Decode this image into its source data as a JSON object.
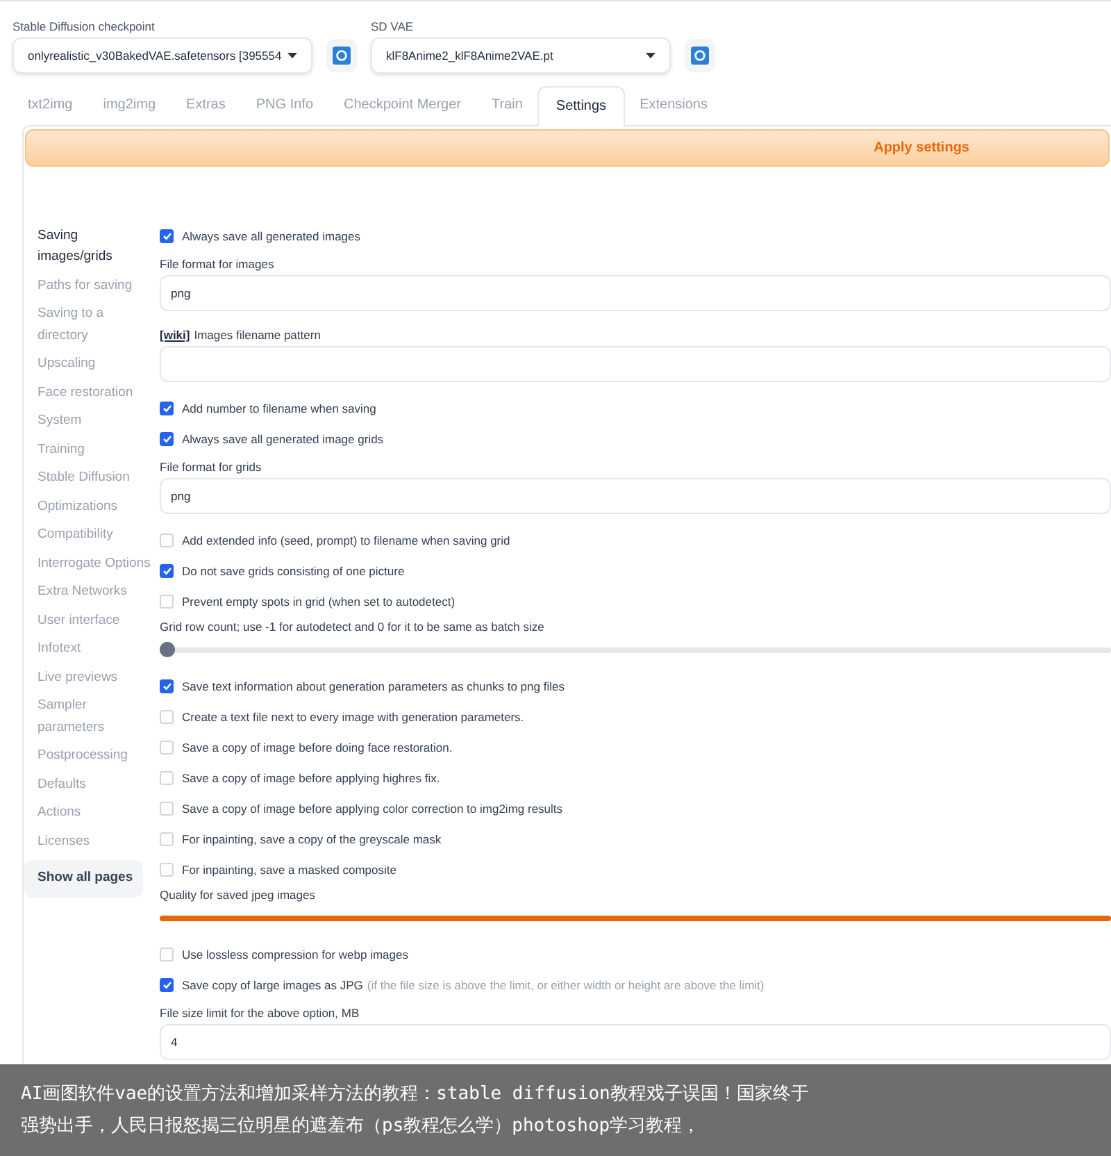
{
  "models": [
    {
      "label": "Stable Diffusion checkpoint",
      "value": "onlyrealistic_v30BakedVAE.safetensors [395554"
    },
    {
      "label": "SD VAE",
      "value": "klF8Anime2_klF8Anime2VAE.pt"
    }
  ],
  "tabs": [
    {
      "label": "txt2img",
      "selected": false
    },
    {
      "label": "img2img",
      "selected": false
    },
    {
      "label": "Extras",
      "selected": false
    },
    {
      "label": "PNG Info",
      "selected": false
    },
    {
      "label": "Checkpoint Merger",
      "selected": false
    },
    {
      "label": "Train",
      "selected": false
    },
    {
      "label": "Settings",
      "selected": true
    },
    {
      "label": "Extensions",
      "selected": false
    }
  ],
  "apply_button": "Apply settings",
  "sidebar": {
    "items": [
      {
        "label": "Saving images/grids",
        "selected": true
      },
      {
        "label": "Paths for saving",
        "selected": false
      },
      {
        "label": "Saving to a directory",
        "selected": false
      },
      {
        "label": "Upscaling",
        "selected": false
      },
      {
        "label": "Face restoration",
        "selected": false
      },
      {
        "label": "System",
        "selected": false
      },
      {
        "label": "Training",
        "selected": false
      },
      {
        "label": "Stable Diffusion",
        "selected": false
      },
      {
        "label": "Optimizations",
        "selected": false
      },
      {
        "label": "Compatibility",
        "selected": false
      },
      {
        "label": "Interrogate Options",
        "selected": false
      },
      {
        "label": "Extra Networks",
        "selected": false
      },
      {
        "label": "User interface",
        "selected": false
      },
      {
        "label": "Infotext",
        "selected": false
      },
      {
        "label": "Live previews",
        "selected": false
      },
      {
        "label": "Sampler parameters",
        "selected": false
      },
      {
        "label": "Postprocessing",
        "selected": false
      },
      {
        "label": "Defaults",
        "selected": false
      },
      {
        "label": "Actions",
        "selected": false
      },
      {
        "label": "Licenses",
        "selected": false
      }
    ],
    "show_all": "Show all pages"
  },
  "settings": [
    {
      "kind": "checkbox",
      "label": "Always save all generated images",
      "checked": true
    },
    {
      "kind": "field",
      "label": "File format for images",
      "value": "png"
    },
    {
      "kind": "field",
      "link": "[wiki]",
      "label": "Images filename pattern"
    },
    {
      "kind": "checkbox",
      "label": "Add number to filename when saving",
      "checked": true
    },
    {
      "kind": "checkbox",
      "label": "Always save all generated image grids",
      "checked": true
    },
    {
      "kind": "field",
      "label": "File format for grids",
      "value": "png"
    },
    {
      "kind": "checkbox",
      "label": "Add extended info (seed, prompt) to filename when saving grid",
      "checked": false
    },
    {
      "kind": "checkbox",
      "label": "Do not save grids consisting of one picture",
      "checked": true
    },
    {
      "kind": "checkbox",
      "label": "Prevent empty spots in grid (when set to autodetect)",
      "checked": false
    },
    {
      "kind": "slider",
      "label": "Grid row count; use -1 for autodetect and 0 for it to be same as batch size",
      "level": 0
    },
    {
      "kind": "checkbox",
      "label": "Save text information about generation parameters as chunks to png files",
      "checked": true
    },
    {
      "kind": "checkbox",
      "label": "Create a text file next to every image with generation parameters.",
      "checked": false
    },
    {
      "kind": "checkbox",
      "label": "Save a copy of image before doing face restoration.",
      "checked": false
    },
    {
      "kind": "checkbox",
      "label": "Save a copy of image before applying highres fix.",
      "checked": false
    },
    {
      "kind": "checkbox",
      "label": "Save a copy of image before applying color correction to img2img results",
      "checked": false
    },
    {
      "kind": "checkbox",
      "label": "For inpainting, save a copy of the greyscale mask",
      "checked": false
    },
    {
      "kind": "checkbox",
      "label": "For inpainting, save a masked composite",
      "checked": false
    },
    {
      "kind": "slider",
      "label": "Quality for saved jpeg images",
      "level": 1
    },
    {
      "kind": "checkbox",
      "label": "Use lossless compression for webp images",
      "checked": false
    },
    {
      "kind": "checkbox",
      "label": "Save copy of large images as JPG",
      "note": "(if the file size is above the limit, or either width or height are above the limit)",
      "checked": true
    },
    {
      "kind": "field",
      "label": "File size limit for the above option, MB",
      "value": "4"
    }
  ],
  "caption": [
    "AI画图软件vae的设置方法和增加采样方法的教程：stable diffusion教程戏子误国！国家终于",
    "强势出手，人民日报怒揭三位明星的遮羞布（ps教程怎么学）photoshop学习教程，"
  ]
}
